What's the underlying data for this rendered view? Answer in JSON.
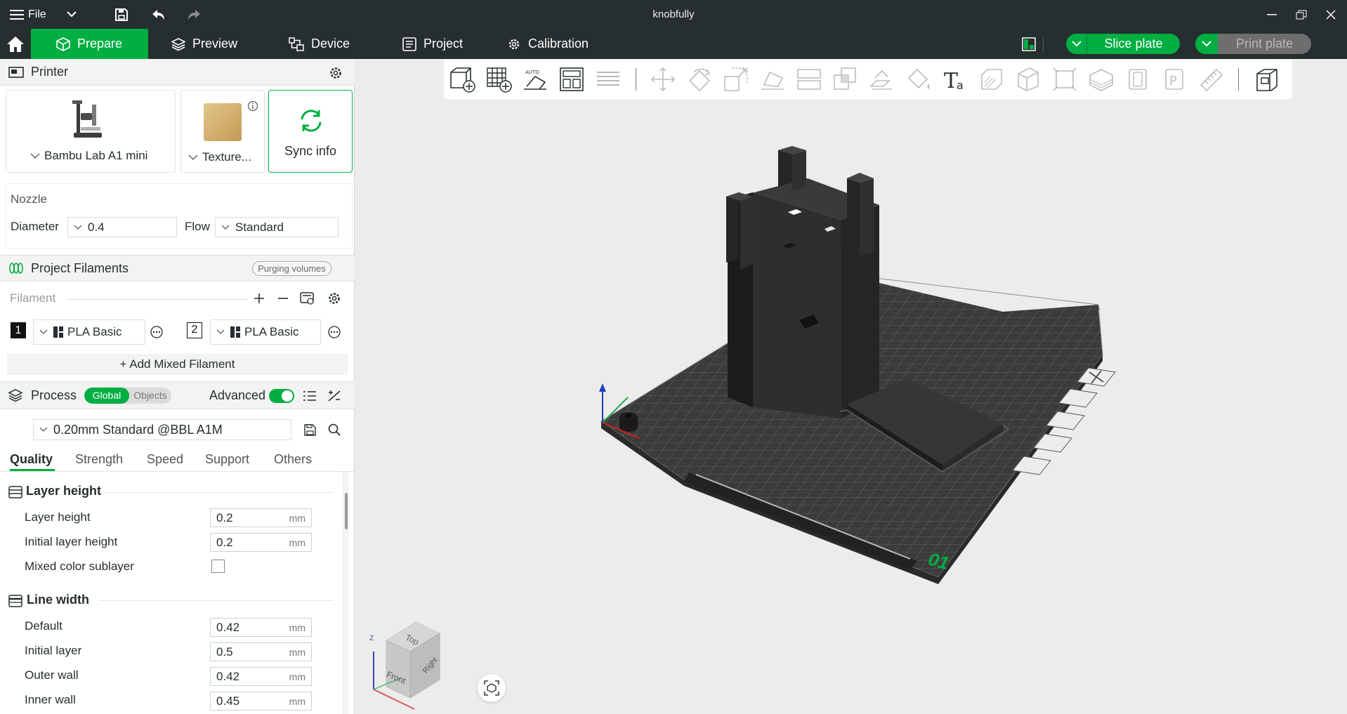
{
  "window": {
    "title": "knobfully",
    "file_label": "File"
  },
  "nav": {
    "tabs": [
      {
        "label": "Prepare",
        "active": true
      },
      {
        "label": "Preview"
      },
      {
        "label": "Device"
      },
      {
        "label": "Project"
      },
      {
        "label": "Calibration"
      }
    ],
    "slice_label": "Slice plate",
    "print_label": "Print plate"
  },
  "printer": {
    "header": "Printer",
    "model": "Bambu Lab A1 mini",
    "plate": "Texture...",
    "sync_label": "Sync info",
    "nozzle_label": "Nozzle",
    "diameter_label": "Diameter",
    "diameter_value": "0.4",
    "flow_label": "Flow",
    "flow_value": "Standard"
  },
  "filaments": {
    "header": "Project Filaments",
    "purging_label": "Purging volumes",
    "filament_label": "Filament",
    "items": [
      {
        "index": "1",
        "name": "PLA Basic"
      },
      {
        "index": "2",
        "name": "PLA Basic"
      }
    ],
    "add_mixed_label": "+ Add Mixed Filament"
  },
  "process": {
    "header": "Process",
    "global_label": "Global",
    "objects_label": "Objects",
    "advanced_label": "Advanced",
    "preset": "0.20mm Standard @BBL A1M",
    "tabs": [
      "Quality",
      "Strength",
      "Speed",
      "Support",
      "Others"
    ],
    "groups": [
      {
        "title": "Layer height",
        "rows": [
          {
            "label": "Layer height",
            "value": "0.2",
            "unit": "mm"
          },
          {
            "label": "Initial layer height",
            "value": "0.2",
            "unit": "mm"
          },
          {
            "label": "Mixed color sublayer"
          }
        ]
      },
      {
        "title": "Line width",
        "rows": [
          {
            "label": "Default",
            "value": "0.42",
            "unit": "mm"
          },
          {
            "label": "Initial layer",
            "value": "0.5",
            "unit": "mm"
          },
          {
            "label": "Outer wall",
            "value": "0.42",
            "unit": "mm"
          },
          {
            "label": "Inner wall",
            "value": "0.45",
            "unit": "mm"
          }
        ]
      }
    ]
  },
  "viewport": {
    "plate_number": "01",
    "cube_labels": {
      "top": "Top",
      "front": "Front",
      "right": "Right",
      "z": "Z"
    }
  },
  "colors": {
    "accent": "#00ae42",
    "titlebar": "#262e30",
    "model": "#262626"
  }
}
